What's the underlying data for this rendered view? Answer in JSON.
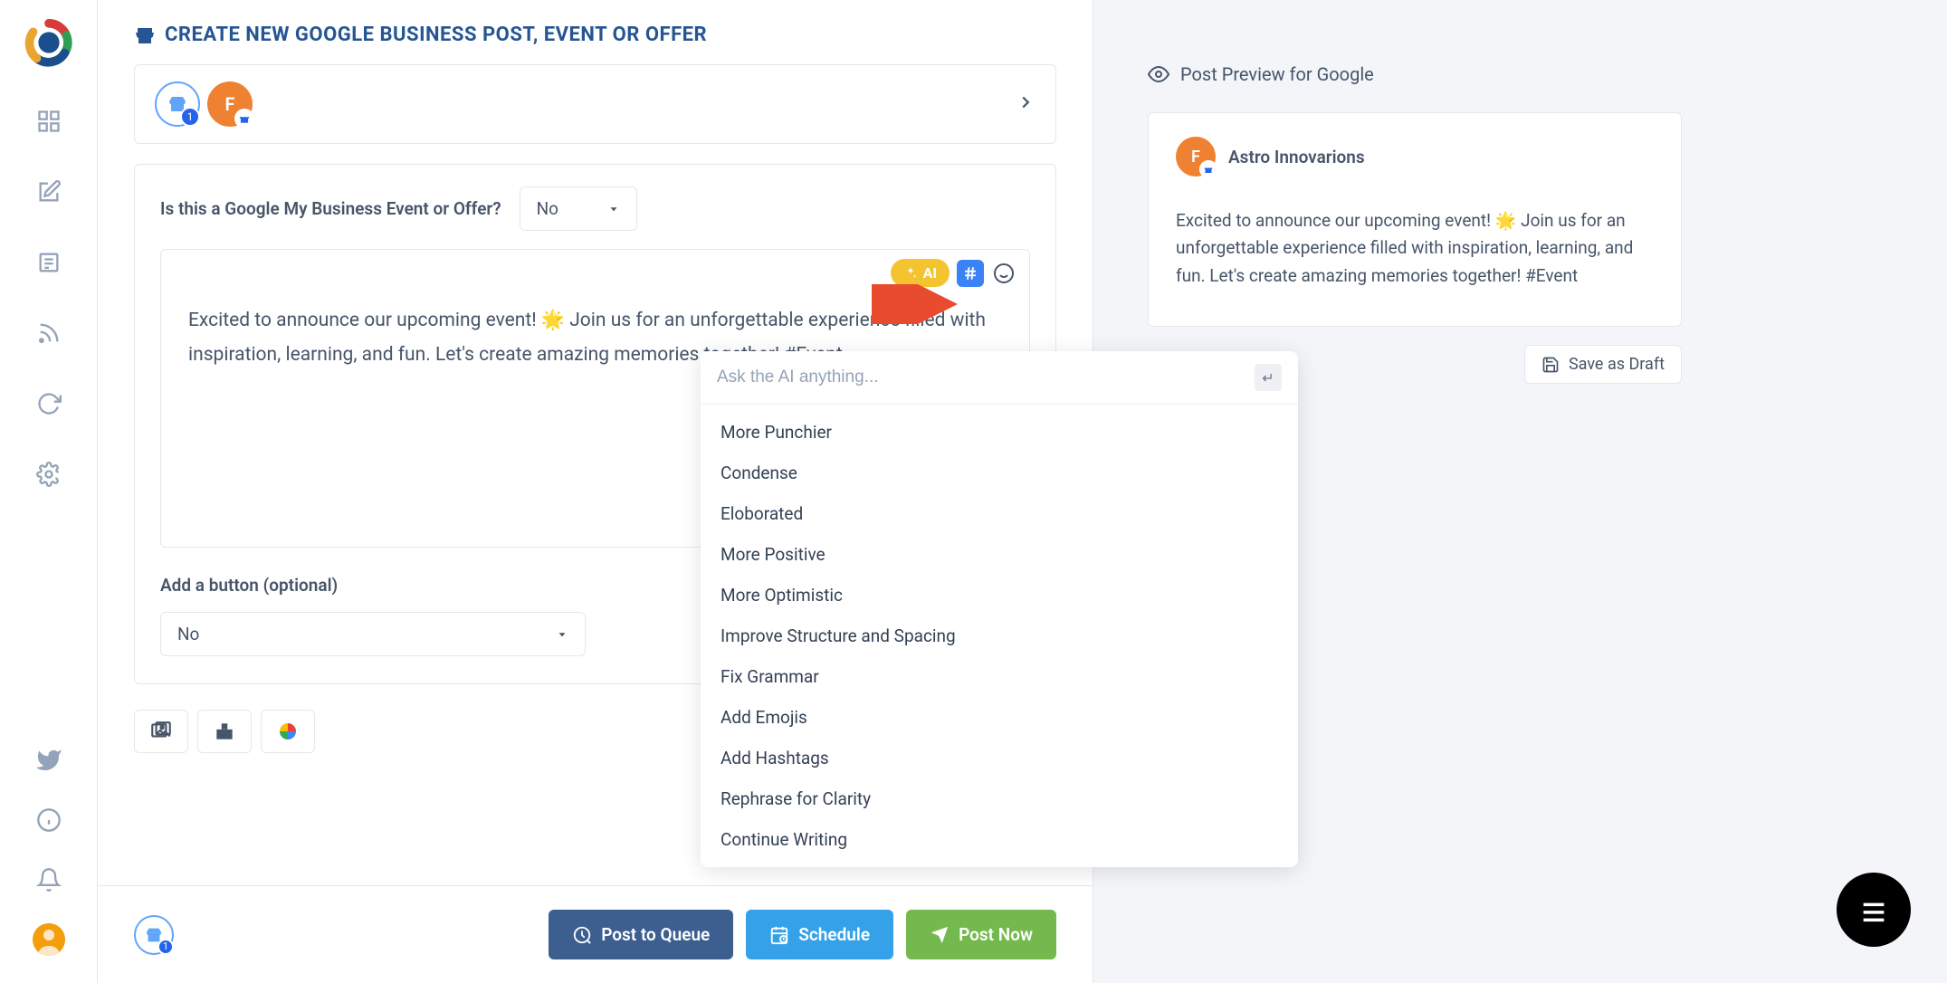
{
  "page_title": "CREATE NEW GOOGLE BUSINESS POST, EVENT OR OFFER",
  "selected_account_badge": "1",
  "avatar_letter": "F",
  "form": {
    "event_offer_label": "Is this a Google My Business Event or Offer?",
    "event_offer_value": "No",
    "add_button_label": "Add a button (optional)",
    "add_button_value": "No"
  },
  "editor_text": "Excited to announce our upcoming event! 🌟 Join us for an unforgettable experience filled with inspiration, learning, and fun. Let's create amazing memories together! #Event",
  "ai": {
    "label": "AI",
    "placeholder": "Ask the AI anything...",
    "submit_glyph": "↵",
    "options": [
      "More Punchier",
      "Condense",
      "Eloborated",
      "More Positive",
      "More Optimistic",
      "Improve Structure and Spacing",
      "Fix Grammar",
      "Add Emojis",
      "Add Hashtags",
      "Rephrase for Clarity",
      "Continue Writing"
    ]
  },
  "footer": {
    "queue": "Post to Queue",
    "schedule": "Schedule",
    "now": "Post Now",
    "badge": "1"
  },
  "preview": {
    "header": "Post Preview for Google",
    "account_name": "Astro Innovarions",
    "avatar_letter": "F",
    "text": "Excited to announce our upcoming event! 🌟 Join us for an unforgettable experience filled with inspiration, learning, and fun. Let's create amazing memories together! #Event",
    "save_draft": "Save as Draft"
  }
}
